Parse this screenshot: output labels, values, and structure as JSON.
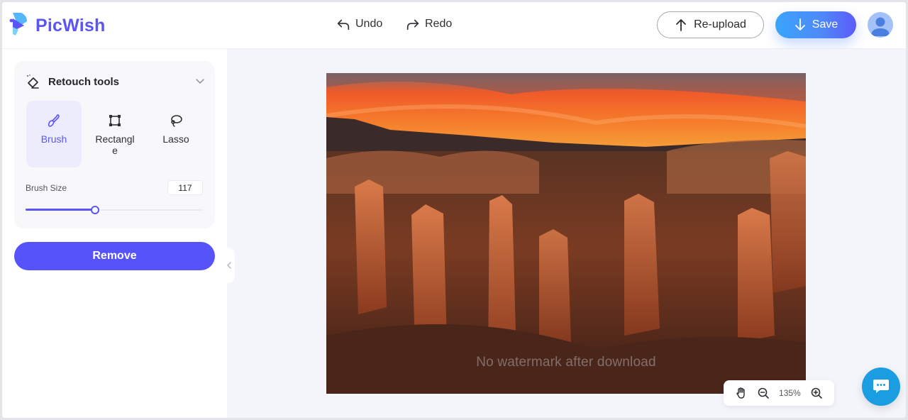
{
  "app": {
    "brand": "PicWish"
  },
  "toolbar": {
    "undo_label": "Undo",
    "redo_label": "Redo",
    "reupload_label": "Re-upload",
    "save_label": "Save"
  },
  "sidebar": {
    "panel_title": "Retouch tools",
    "tools": [
      {
        "label": "Brush",
        "icon": "brush-icon",
        "active": true
      },
      {
        "label": "Rectangle",
        "icon": "rectangle-select-icon",
        "active": false
      },
      {
        "label": "Lasso",
        "icon": "lasso-icon",
        "active": false
      }
    ],
    "brush_size_label": "Brush Size",
    "brush_size_value": "117",
    "brush_size_fraction": 0.39,
    "remove_label": "Remove"
  },
  "canvas": {
    "watermark": "No watermark after download",
    "zoom_level": "135%"
  },
  "colors": {
    "brand": "#5b55f5",
    "save_gradient_start": "#3aa4fb",
    "save_gradient_end": "#5b5bf8",
    "remove_button": "#5753fa",
    "chat_bubble": "#1a9ee1"
  }
}
